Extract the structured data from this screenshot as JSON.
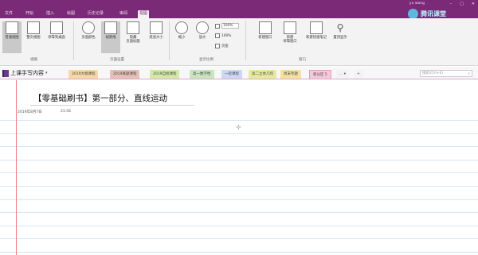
{
  "titlebar": {
    "user": "yu wang",
    "min": "–",
    "max": "□",
    "close": "✕"
  },
  "menu": {
    "tabs": [
      "文件",
      "开始",
      "插入",
      "绘图",
      "历史记录",
      "审阅",
      "视图"
    ],
    "active_index": 6
  },
  "logo": {
    "text": "腾讯课堂"
  },
  "ribbon": {
    "views": {
      "normal": "普通视图",
      "full": "整页视图",
      "dock": "停靠到桌面",
      "group": "视图"
    },
    "page_setup": {
      "color": "页面颜色",
      "rule": "规则线",
      "hide_title": "隐藏\n页面标题",
      "paper_size": "纸张大小",
      "group": "页面设置"
    },
    "zoom": {
      "out": "缩小",
      "in": "放大",
      "level": "100%",
      "pct": "100%",
      "width": "页宽",
      "group": "显示比例"
    },
    "window": {
      "new_window": "新建窗口",
      "dock_new": "新建\n停靠窗口",
      "quick_note": "新建快速笔记",
      "always_top": "置顶显示",
      "group": "窗口"
    }
  },
  "notebook": {
    "name": "上课手写内容",
    "caret": "▾"
  },
  "sections": [
    {
      "label": "2019大纲课程",
      "color": "#f6d7a7"
    },
    {
      "label": "2019真题课程",
      "color": "#e6bfb8"
    },
    {
      "label": "2019自招课程",
      "color": "#d4e9a9"
    },
    {
      "label": "高一数学性",
      "color": "#c8e5c0"
    },
    {
      "label": "一轮课程",
      "color": "#cdd6f2"
    },
    {
      "label": "高二立体几何",
      "color": "#e6ea9e"
    },
    {
      "label": "周末专题",
      "color": "#f3e0a2"
    },
    {
      "label": "新分区 5",
      "color": "#f5c9d8"
    },
    {
      "label": "... ▾",
      "color": "#f3f3f3"
    },
    {
      "label": "+",
      "color": "#f3f3f3"
    }
  ],
  "search": {
    "placeholder": "搜索(Ctrl+E)",
    "icon": "search-icon"
  },
  "page": {
    "title": "【零基础刷书】第一部分、直线运动",
    "date": "2019年8月7日",
    "time": "21:56"
  },
  "colors": {
    "brand": "#7b2a78",
    "margin": "#f08080",
    "rule": "#dbe4ef"
  }
}
